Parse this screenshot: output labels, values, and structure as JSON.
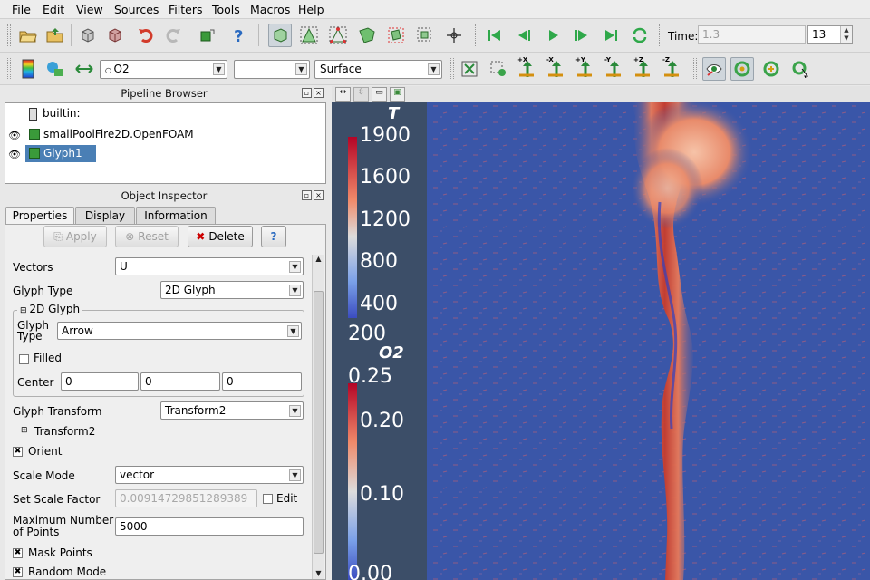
{
  "menubar": [
    "File",
    "Edit",
    "View",
    "Sources",
    "Filters",
    "Tools",
    "Macros",
    "Help"
  ],
  "time": {
    "label": "Time:",
    "value": "1.3",
    "step": "13"
  },
  "toolbar2": {
    "array_combo": "O2",
    "component_combo": "",
    "representation_combo": "Surface"
  },
  "axis_buttons": [
    "+X",
    "-X",
    "+Y",
    "-Y",
    "+Z",
    "-Z"
  ],
  "pipeline": {
    "title": "Pipeline Browser",
    "items": [
      {
        "label": "builtin:"
      },
      {
        "label": "smallPoolFire2D.OpenFOAM"
      },
      {
        "label": "Glyph1"
      }
    ]
  },
  "inspector": {
    "title": "Object Inspector",
    "tabs": [
      "Properties",
      "Display",
      "Information"
    ],
    "buttons": {
      "apply": "Apply",
      "reset": "Reset",
      "delete": "Delete",
      "help": "?"
    },
    "vectors": {
      "label": "Vectors",
      "value": "U"
    },
    "glyph_type": {
      "label": "Glyph Type",
      "value": "2D Glyph"
    },
    "glyph2d": {
      "title": "2D Glyph",
      "type_label": "Glyph Type",
      "type_value": "Arrow",
      "filled": "Filled",
      "center_label": "Center",
      "center": [
        "0",
        "0",
        "0"
      ]
    },
    "glyph_transform": {
      "label": "Glyph Transform",
      "value": "Transform2",
      "tree": "Transform2"
    },
    "orient": "Orient",
    "scale_mode": {
      "label": "Scale Mode",
      "value": "vector"
    },
    "scale_factor": {
      "label": "Set Scale Factor",
      "value": "0.00914729851289389",
      "edit": "Edit"
    },
    "max_points": {
      "label1": "Maximum Number",
      "label2": "of Points",
      "value": "5000"
    },
    "mask_points": "Mask Points",
    "random_mode": "Random Mode"
  },
  "legend_T": {
    "title": "T",
    "ticks": [
      "1900",
      "1600",
      "1200",
      "800",
      "400",
      "200"
    ]
  },
  "legend_O2": {
    "title": "O2",
    "ticks": [
      "0.25",
      "0.20",
      "0.10",
      "0.00"
    ]
  },
  "colors": {
    "bg_view": "#3a56a8",
    "panel": "#3c4e68",
    "flame": "#e0553a"
  }
}
